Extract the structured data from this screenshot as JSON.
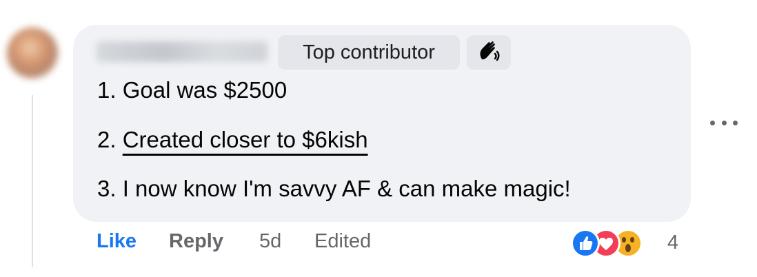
{
  "comment": {
    "badge": "Top contributor",
    "badge_icon": "hand-wave-icon",
    "lines": [
      {
        "number": "1.",
        "text": "Goal was $2500"
      },
      {
        "number": "2.",
        "text": "Created closer to $6kish"
      },
      {
        "number": "3.",
        "text": "I now know I'm savvy AF & can make magic!"
      }
    ]
  },
  "actions": {
    "like": "Like",
    "reply": "Reply",
    "time": "5d",
    "edited": "Edited"
  },
  "reactions": {
    "icons": [
      "thumbs-up-icon",
      "heart-icon",
      "wow-face-icon"
    ],
    "count": "4"
  },
  "colors": {
    "bubble": "#f0f2f5",
    "like_blue": "#1877f2",
    "muted": "#65676b"
  }
}
